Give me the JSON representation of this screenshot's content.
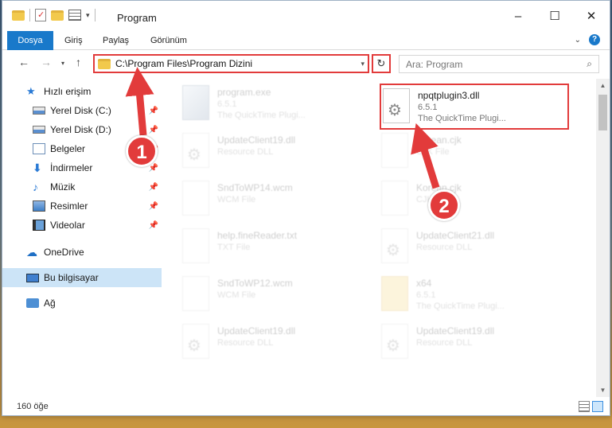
{
  "window": {
    "title": "Program",
    "controls": {
      "minimize": "–",
      "maximize": "☐",
      "close": "✕"
    }
  },
  "ribbon": {
    "tabs": [
      {
        "label": "Dosya"
      },
      {
        "label": "Giriş"
      },
      {
        "label": "Paylaş"
      },
      {
        "label": "Görünüm"
      }
    ],
    "help": "?"
  },
  "navigation": {
    "back": "←",
    "forward": "→",
    "up": "↑",
    "address": "C:\\Program Files\\Program Dizini",
    "refresh": "↻",
    "search_placeholder": "Ara: Program",
    "search_icon": "⌕"
  },
  "sidebar": {
    "items": [
      {
        "label": "Hızlı erişim",
        "icon": "star-icon"
      },
      {
        "label": "Yerel Disk (C:)",
        "icon": "drive-icon",
        "pinned": true
      },
      {
        "label": "Yerel Disk (D:)",
        "icon": "drive-icon",
        "pinned": true
      },
      {
        "label": "Belgeler",
        "icon": "document-icon",
        "pinned": true
      },
      {
        "label": "İndirmeler",
        "icon": "download-icon",
        "pinned": true
      },
      {
        "label": "Müzik",
        "icon": "music-icon",
        "pinned": true
      },
      {
        "label": "Resimler",
        "icon": "pictures-icon",
        "pinned": true
      },
      {
        "label": "Videolar",
        "icon": "videos-icon",
        "pinned": true
      },
      {
        "label": "OneDrive",
        "icon": "cloud-icon"
      },
      {
        "label": "Bu bilgisayar",
        "icon": "computer-icon",
        "selected": true
      },
      {
        "label": "Ağ",
        "icon": "network-icon"
      }
    ]
  },
  "files": [
    {
      "name": "program.exe",
      "line1": "6.5.1",
      "line2": "The QuickTime Plugi...",
      "faded": true
    },
    {
      "name": "npqtplugin3.dll",
      "line1": "6.5.1",
      "line2": "The QuickTime Plugi...",
      "faded": false
    },
    {
      "name": "UpdateClient19.dll",
      "line1": "Resource DLL",
      "line2": "",
      "faded": true
    },
    {
      "name": "Korean.cjk",
      "line1": "CJK File",
      "line2": "",
      "faded": true
    },
    {
      "name": "SndToWP14.wcm",
      "line1": "WCM File",
      "line2": "",
      "faded": true
    },
    {
      "name": "Korean.cjk",
      "line1": "CJK File",
      "line2": "",
      "faded": true
    },
    {
      "name": "help.fineReader.txt",
      "line1": "TXT File",
      "line2": "",
      "faded": true
    },
    {
      "name": "UpdateClient21.dll",
      "line1": "Resource DLL",
      "line2": "",
      "faded": true
    },
    {
      "name": "SndToWP12.wcm",
      "line1": "WCM File",
      "line2": "",
      "faded": true
    },
    {
      "name": "x64",
      "line1": "6.5.1",
      "line2": "The QuickTime Plugi...",
      "faded": true
    },
    {
      "name": "UpdateClient19.dll",
      "line1": "Resource DLL",
      "line2": "",
      "faded": true
    },
    {
      "name": "UpdateClient19.dll",
      "line1": "Resource DLL",
      "line2": "",
      "faded": true
    }
  ],
  "status": {
    "item_count": "160 öğe"
  },
  "annotations": {
    "step1": "1",
    "step2": "2"
  },
  "colors": {
    "accent": "#1979ca",
    "highlight": "#e23b3b",
    "selected": "#cce4f7"
  }
}
